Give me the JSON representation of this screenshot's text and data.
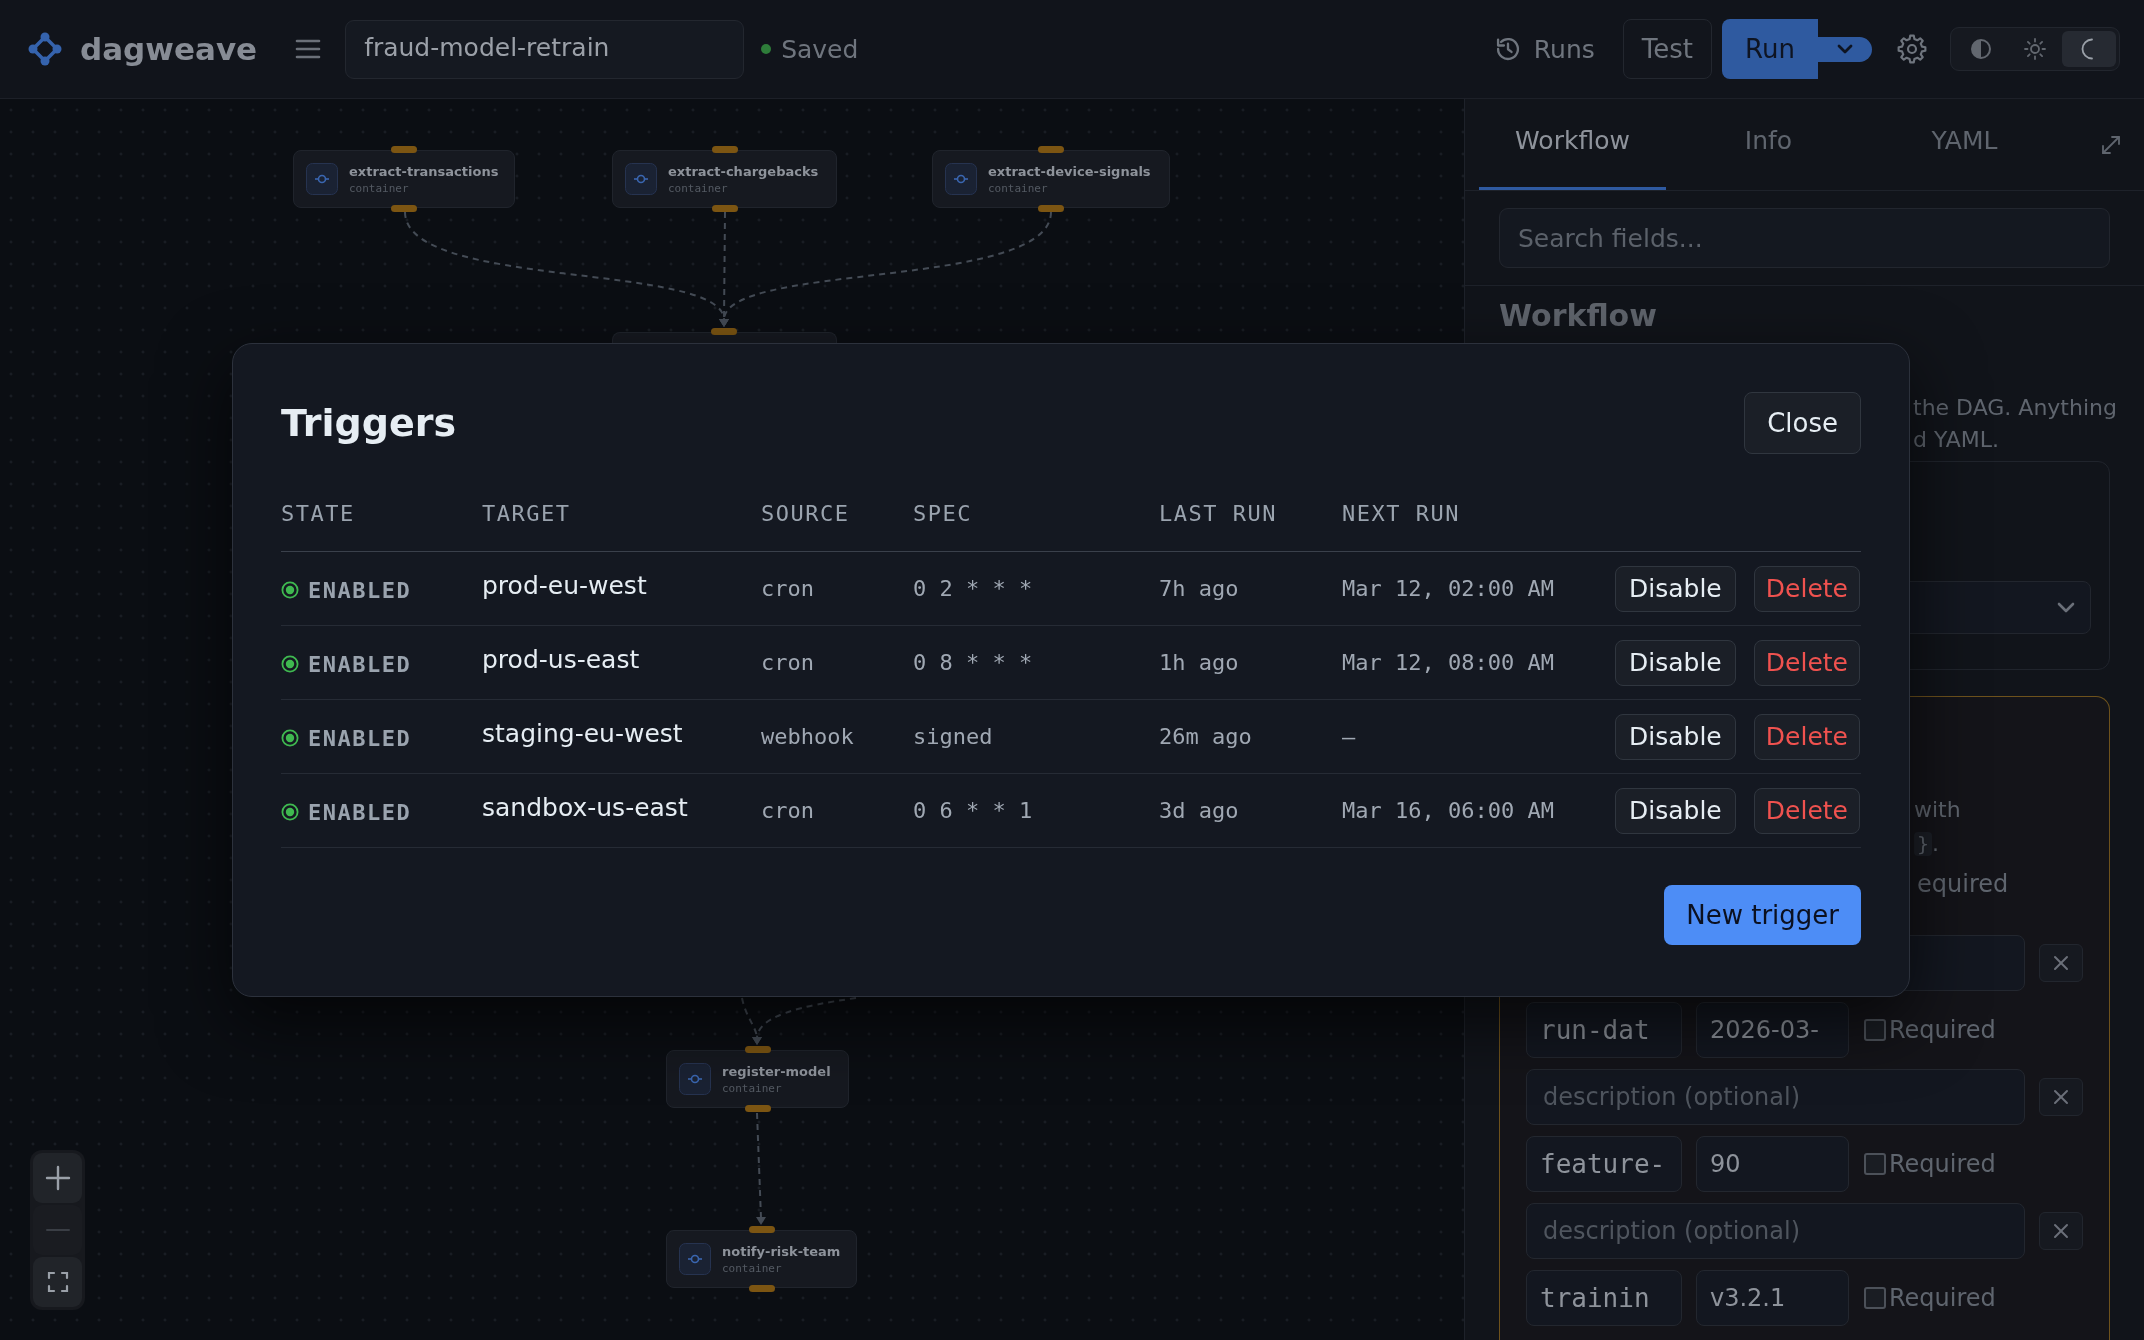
{
  "topbar": {
    "app_name": "dagweave",
    "workflow_name": "fraud-model-retrain",
    "save_status": "Saved",
    "runs_label": "Runs",
    "test_label": "Test",
    "run_label": "Run",
    "theme_options": [
      {
        "kind": "contrast",
        "selected": false
      },
      {
        "kind": "light",
        "selected": false
      },
      {
        "kind": "dark",
        "selected": true
      }
    ]
  },
  "canvas": {
    "nodes": [
      {
        "name": "extract-transactions",
        "type": "container"
      },
      {
        "name": "extract-chargebacks",
        "type": "container"
      },
      {
        "name": "extract-device-signals",
        "type": "container"
      },
      {
        "name": "register-model",
        "type": "container"
      },
      {
        "name": "notify-risk-team",
        "type": "container"
      }
    ],
    "zoom_controls": [
      {
        "kind": "zoom-in",
        "disabled": false
      },
      {
        "kind": "zoom-out",
        "disabled": true
      },
      {
        "kind": "fit",
        "disabled": false
      }
    ]
  },
  "panel": {
    "tabs": [
      {
        "label": "Workflow",
        "selected": true
      },
      {
        "label": "Info",
        "selected": false
      },
      {
        "label": "YAML",
        "selected": false
      }
    ],
    "search": {
      "placeholder": "Search fields..."
    },
    "section_title": "Workflow",
    "description_lines": [
      "the DAG. Anything",
      "d YAML."
    ],
    "parameters": {
      "help_text": {
        "line_1": "with",
        "code": "}",
        "tail": "."
      },
      "cut_label": "equired",
      "rows": [
        {
          "kind": "description"
        },
        {
          "kind": "param",
          "key": "run-dat",
          "value": "2026-03-",
          "required": false,
          "required_label": "Required"
        },
        {
          "kind": "description",
          "placeholder": "description (optional)"
        },
        {
          "kind": "param",
          "key": "feature-",
          "value": "90",
          "required": false,
          "required_label": "Required"
        },
        {
          "kind": "description",
          "placeholder": "description (optional)"
        },
        {
          "kind": "param",
          "key": "trainin",
          "value": "v3.2.1",
          "required": false,
          "required_label": "Required"
        }
      ]
    }
  },
  "triggers_dialog": {
    "title": "Triggers",
    "close_label": "Close",
    "columns": [
      "STATE",
      "TARGET",
      "SOURCE",
      "SPEC",
      "LAST RUN",
      "NEXT RUN"
    ],
    "rows": [
      {
        "enabled": true,
        "state": "ENABLED",
        "target": "prod-eu-west",
        "source": "cron",
        "spec": "0 2 * * *",
        "last_run": "7h ago",
        "next_run": "Mar 12, 02:00 AM",
        "disable_label": "Disable",
        "delete_label": "Delete"
      },
      {
        "enabled": true,
        "state": "ENABLED",
        "target": "prod-us-east",
        "source": "cron",
        "spec": "0 8 * * *",
        "last_run": "1h ago",
        "next_run": "Mar 12, 08:00 AM",
        "disable_label": "Disable",
        "delete_label": "Delete"
      },
      {
        "enabled": true,
        "state": "ENABLED",
        "target": "staging-eu-west",
        "source": "webhook",
        "spec": "signed",
        "last_run": "26m ago",
        "next_run": "—",
        "disable_label": "Disable",
        "delete_label": "Delete"
      },
      {
        "enabled": true,
        "state": "ENABLED",
        "target": "sandbox-us-east",
        "source": "cron",
        "spec": "0 6 * * 1",
        "last_run": "3d ago",
        "next_run": "Mar 16, 06:00 AM",
        "disable_label": "Disable",
        "delete_label": "Delete"
      }
    ],
    "new_trigger_label": "New trigger"
  }
}
